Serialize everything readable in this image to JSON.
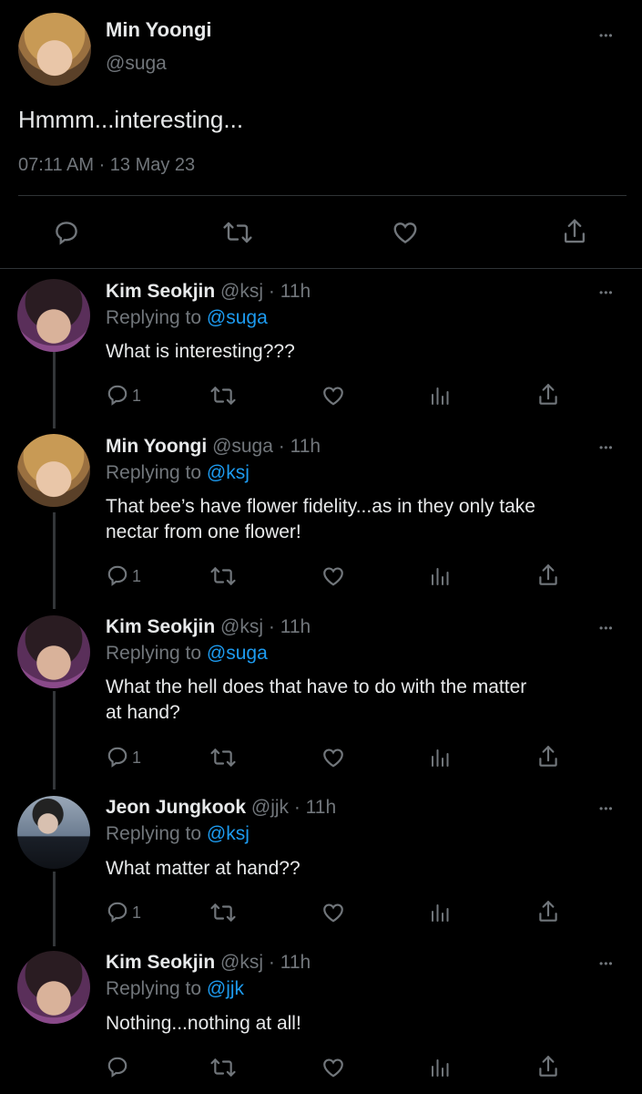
{
  "main_tweet": {
    "name": "Min Yoongi",
    "handle": "@suga",
    "text": "Hmmm...interesting...",
    "timestamp": "07:11 AM · 13 May 23",
    "more_label": "•••"
  },
  "replies": [
    {
      "name": "Kim Seokjin",
      "meta": "@ksj · 11h",
      "replying_prefix": "Replying to ",
      "replying_to": "@suga",
      "text_lines": [
        "What is interesting???"
      ],
      "reply_count": "1",
      "more_label": "•••"
    },
    {
      "name": "Min Yoongi",
      "meta": "@suga · 11h",
      "replying_prefix": "Replying to ",
      "replying_to": "@ksj",
      "text_lines": [
        "That bee’s have flower fidelity...as in they only take",
        "nectar from one flower!"
      ],
      "reply_count": "1",
      "more_label": "•••"
    },
    {
      "name": "Kim Seokjin",
      "meta": "@ksj · 11h",
      "replying_prefix": "Replying to ",
      "replying_to": "@suga",
      "text_lines": [
        "What the hell does that have to do with the matter",
        "at hand?"
      ],
      "reply_count": "1",
      "more_label": "•••"
    },
    {
      "name": "Jeon Jungkook",
      "meta": "@jjk · 11h",
      "replying_prefix": "Replying to ",
      "replying_to": "@ksj",
      "text_lines": [
        "What matter at hand??"
      ],
      "reply_count": "1",
      "more_label": "•••"
    },
    {
      "name": "Kim Seokjin",
      "meta": "@ksj · 11h",
      "replying_prefix": "Replying to ",
      "replying_to": "@jjk",
      "text_lines": [
        "Nothing...nothing at all!"
      ],
      "reply_count": "",
      "more_label": "•••"
    }
  ],
  "icons": {
    "reply": "speech-bubble-icon",
    "retweet": "retweet-icon",
    "like": "heart-icon",
    "views": "bar-chart-icon",
    "share": "share-icon"
  },
  "colors": {
    "background": "#000000",
    "text": "#e7e9ea",
    "muted": "#71767b",
    "link": "#1d9bf0",
    "divider": "#2f3336"
  }
}
